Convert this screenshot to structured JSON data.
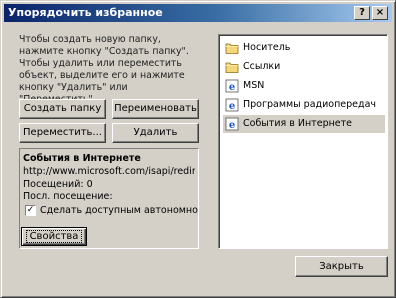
{
  "window": {
    "title": "Упорядочить избранное"
  },
  "caption_buttons": {
    "help": "?",
    "close": "×"
  },
  "instructions": "Чтобы создать новую папку, нажмите кнопку \"Создать папку\". Чтобы удалить или переместить объект, выделите его и нажмите кнопку \"Удалить\" или \"Переместить\".",
  "buttons": {
    "create_folder": "Создать папку",
    "rename": "Переименовать",
    "move": "Переместить...",
    "delete": "Удалить",
    "properties": "Свойства",
    "close": "Закрыть"
  },
  "details": {
    "name": "События в Интернете",
    "url": "http://www.microsoft.com/isapi/redir.dll...",
    "visits": "Посещений: 0",
    "last_visit": "Посл. посещение:",
    "offline_label": "Сделать доступным автономно",
    "offline_checked": "✓"
  },
  "favorites": [
    {
      "label": "Носитель",
      "icon": "folder-icon"
    },
    {
      "label": "Ссылки",
      "icon": "folder-icon"
    },
    {
      "label": "MSN",
      "icon": "ie-link-icon"
    },
    {
      "label": "Программы радиопередач",
      "icon": "ie-link-icon"
    },
    {
      "label": "События в Интернете",
      "icon": "ie-link-icon",
      "selected": true
    }
  ],
  "colors": {
    "title_start": "#0a246a",
    "title_end": "#a6caf0",
    "face": "#d4d0c8"
  }
}
